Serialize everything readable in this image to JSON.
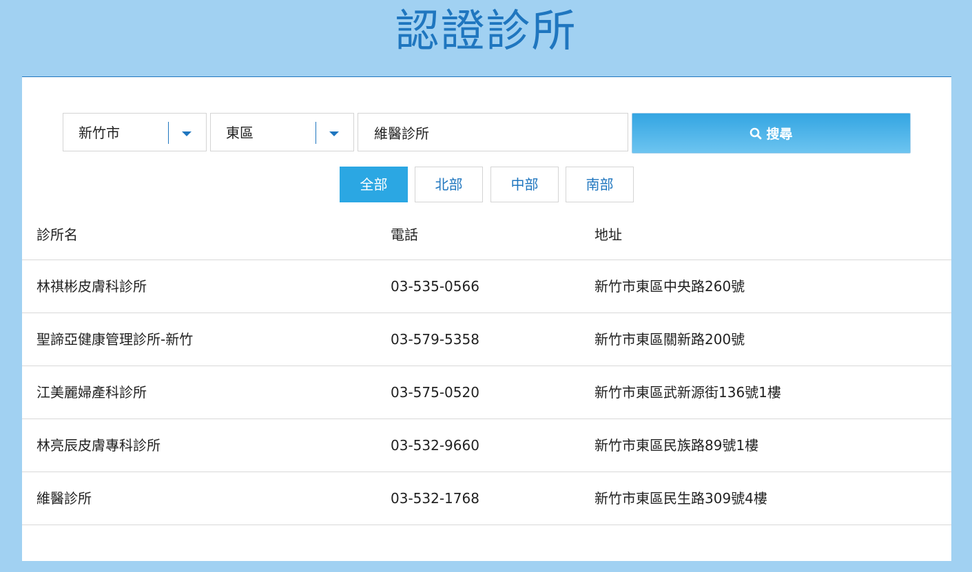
{
  "page": {
    "title": "認證診所"
  },
  "filters": {
    "city": "新竹市",
    "district": "東區",
    "keyword": "維醫診所",
    "search_label": "搜尋"
  },
  "regions": [
    {
      "label": "全部",
      "active": true
    },
    {
      "label": "北部",
      "active": false
    },
    {
      "label": "中部",
      "active": false
    },
    {
      "label": "南部",
      "active": false
    }
  ],
  "table": {
    "headers": {
      "name": "診所名",
      "phone": "電話",
      "address": "地址"
    },
    "rows": [
      {
        "name": "林祺彬皮膚科診所",
        "phone": "03-535-0566",
        "address": "新竹市東區中央路260號"
      },
      {
        "name": "聖諦亞健康管理診所-新竹",
        "phone": "03-579-5358",
        "address": "新竹市東區關新路200號"
      },
      {
        "name": "江美麗婦產科診所",
        "phone": "03-575-0520",
        "address": "新竹市東區武新源街136號1樓"
      },
      {
        "name": "林亮辰皮膚專科診所",
        "phone": "03-532-9660",
        "address": "新竹市東區民族路89號1樓"
      },
      {
        "name": "維醫診所",
        "phone": "03-532-1768",
        "address": "新竹市東區民生路309號4樓"
      }
    ]
  },
  "colors": {
    "background": "#a1d1f2",
    "accent": "#1f76bf",
    "button": "#2ba7e3"
  },
  "icons": {
    "search": "search-icon",
    "dropdown": "caret-down-icon"
  }
}
